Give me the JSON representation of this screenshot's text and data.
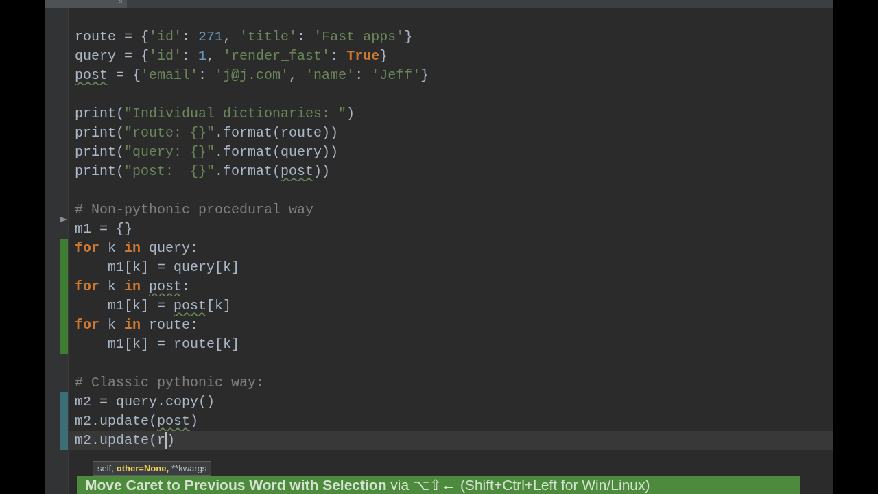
{
  "editor": {
    "lines": [
      {
        "fold": false,
        "current": false
      },
      {
        "fold": false,
        "current": false,
        "tokens": [
          {
            "kind": "plain",
            "text": "route = {"
          },
          {
            "kind": "string",
            "text": "'id'"
          },
          {
            "kind": "plain",
            "text": ": "
          },
          {
            "kind": "number",
            "text": "271"
          },
          {
            "kind": "plain",
            "text": ", "
          },
          {
            "kind": "string",
            "text": "'title'"
          },
          {
            "kind": "plain",
            "text": ": "
          },
          {
            "kind": "string",
            "text": "'Fast apps'"
          },
          {
            "kind": "plain",
            "text": "}"
          }
        ]
      },
      {
        "fold": false,
        "current": false,
        "tokens": [
          {
            "kind": "plain",
            "text": "query = {"
          },
          {
            "kind": "string",
            "text": "'id'"
          },
          {
            "kind": "plain",
            "text": ": "
          },
          {
            "kind": "number",
            "text": "1"
          },
          {
            "kind": "plain",
            "text": ", "
          },
          {
            "kind": "string",
            "text": "'render_fast'"
          },
          {
            "kind": "plain",
            "text": ": "
          },
          {
            "kind": "keyword",
            "text": "True"
          },
          {
            "kind": "plain",
            "text": "}"
          }
        ]
      },
      {
        "fold": false,
        "current": false,
        "tokens": [
          {
            "kind": "warn",
            "text": "post"
          },
          {
            "kind": "plain",
            "text": " = {"
          },
          {
            "kind": "string",
            "text": "'email'"
          },
          {
            "kind": "plain",
            "text": ": "
          },
          {
            "kind": "string",
            "text": "'j@j.com'"
          },
          {
            "kind": "plain",
            "text": ", "
          },
          {
            "kind": "string",
            "text": "'name'"
          },
          {
            "kind": "plain",
            "text": ": "
          },
          {
            "kind": "string",
            "text": "'Jeff'"
          },
          {
            "kind": "plain",
            "text": "}"
          }
        ]
      },
      {
        "fold": false,
        "current": false
      },
      {
        "fold": false,
        "current": false,
        "tokens": [
          {
            "kind": "plain",
            "text": "print("
          },
          {
            "kind": "string",
            "text": "\"Individual dictionaries: \""
          },
          {
            "kind": "plain",
            "text": ")"
          }
        ]
      },
      {
        "fold": false,
        "current": false,
        "tokens": [
          {
            "kind": "plain",
            "text": "print("
          },
          {
            "kind": "string",
            "text": "\"route: {}\""
          },
          {
            "kind": "plain",
            "text": ".format(route))"
          }
        ]
      },
      {
        "fold": false,
        "current": false,
        "tokens": [
          {
            "kind": "plain",
            "text": "print("
          },
          {
            "kind": "string",
            "text": "\"query: {}\""
          },
          {
            "kind": "plain",
            "text": ".format(query))"
          }
        ]
      },
      {
        "fold": false,
        "current": false,
        "tokens": [
          {
            "kind": "plain",
            "text": "print("
          },
          {
            "kind": "string",
            "text": "\"post:  {}\""
          },
          {
            "kind": "plain",
            "text": ".format("
          },
          {
            "kind": "warn",
            "text": "post"
          },
          {
            "kind": "plain",
            "text": "))"
          }
        ]
      },
      {
        "fold": false,
        "current": false
      },
      {
        "fold": false,
        "current": false,
        "tokens": [
          {
            "kind": "comment",
            "text": "# Non-pythonic procedural way"
          }
        ]
      },
      {
        "fold": true,
        "current": false,
        "tokens": [
          {
            "kind": "plain",
            "text": "m1 = {}"
          }
        ]
      },
      {
        "kind": "added",
        "fold": false,
        "current": false,
        "tokens": [
          {
            "kind": "keyword",
            "text": "for"
          },
          {
            "kind": "plain",
            "text": " k "
          },
          {
            "kind": "keyword",
            "text": "in"
          },
          {
            "kind": "plain",
            "text": " query:"
          }
        ]
      },
      {
        "kind": "added",
        "fold": false,
        "current": false,
        "tokens": [
          {
            "kind": "plain",
            "text": "    m1[k] = query[k]"
          }
        ]
      },
      {
        "kind": "added",
        "fold": false,
        "current": false,
        "tokens": [
          {
            "kind": "keyword",
            "text": "for"
          },
          {
            "kind": "plain",
            "text": " k "
          },
          {
            "kind": "keyword",
            "text": "in "
          },
          {
            "kind": "warn",
            "text": "post"
          },
          {
            "kind": "plain",
            "text": ":"
          }
        ]
      },
      {
        "kind": "added",
        "fold": false,
        "current": false,
        "tokens": [
          {
            "kind": "plain",
            "text": "    m1[k] = "
          },
          {
            "kind": "warn",
            "text": "post"
          },
          {
            "kind": "plain",
            "text": "[k]"
          }
        ]
      },
      {
        "kind": "added",
        "fold": false,
        "current": false,
        "tokens": [
          {
            "kind": "keyword",
            "text": "for"
          },
          {
            "kind": "plain",
            "text": " k "
          },
          {
            "kind": "keyword",
            "text": "in"
          },
          {
            "kind": "plain",
            "text": " route:"
          }
        ]
      },
      {
        "kind": "added",
        "fold": false,
        "current": false,
        "tokens": [
          {
            "kind": "plain",
            "text": "    m1[k] = route[k]"
          }
        ]
      },
      {
        "fold": false,
        "current": false
      },
      {
        "fold": false,
        "current": false,
        "tokens": [
          {
            "kind": "comment",
            "text": "# Classic pythonic way:"
          }
        ]
      },
      {
        "kind": "modified",
        "fold": false,
        "current": false,
        "tokens": [
          {
            "kind": "plain",
            "text": "m2 = query.copy()"
          }
        ]
      },
      {
        "kind": "modified",
        "fold": false,
        "current": false,
        "tokens": [
          {
            "kind": "plain",
            "text": "m2.update("
          },
          {
            "kind": "warn",
            "text": "post"
          },
          {
            "kind": "plain",
            "text": ")"
          }
        ]
      },
      {
        "kind": "modified",
        "fold": false,
        "current": true,
        "tokens": [
          {
            "kind": "plain",
            "text": "m2.update(r"
          },
          {
            "kind": "caret"
          },
          {
            "kind": "plain",
            "text": ")"
          }
        ]
      }
    ]
  },
  "parameter_hint": [
    {
      "text": "self,",
      "current": false
    },
    {
      "text": "other=None,",
      "current": true
    },
    {
      "text": "**kwargs",
      "current": false
    }
  ],
  "shortcut_banner": "**Move Caret to Previous Word with Selection** via ⌥⇧← (Shift+Ctrl+Left for Win/Linux)"
}
